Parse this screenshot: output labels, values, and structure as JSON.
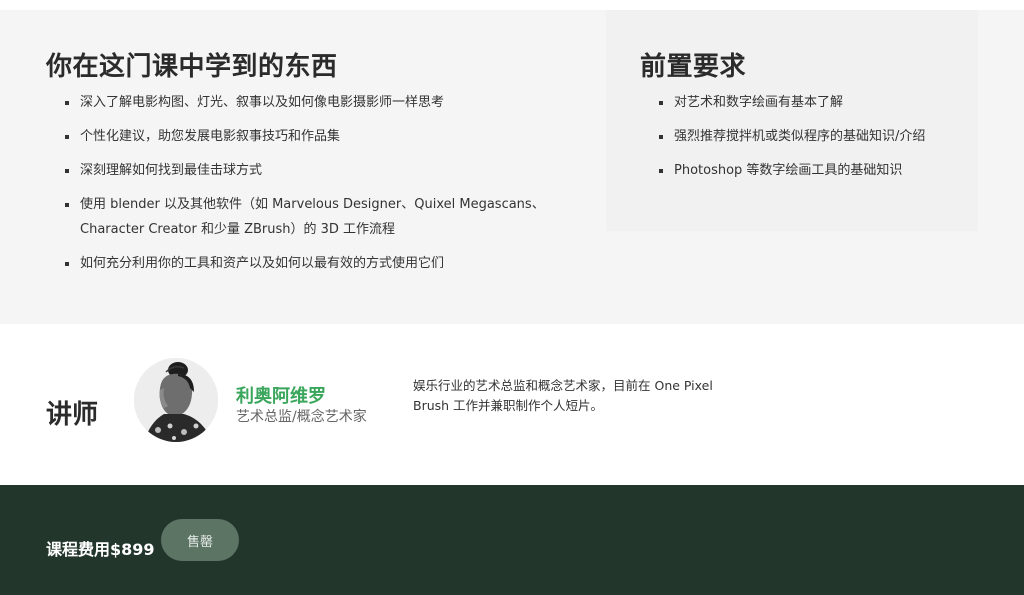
{
  "learn": {
    "title": "你在这门课中学到的东西",
    "items": [
      "深入了解电影构图、灯光、叙事以及如何像电影摄影师一样思考",
      "个性化建议，助您发展电影叙事技巧和作品集",
      "深刻理解如何找到最佳击球方式",
      "使用 blender 以及其他软件（如 Marvelous Designer、Quixel Megascans、Character Creator 和少量 ZBrush）的 3D 工作流程",
      "如何充分利用你的工具和资产以及如何以最有效的方式使用它们"
    ]
  },
  "prerequisites": {
    "title": "前置要求",
    "items": [
      "对艺术和数字绘画有基本了解",
      "强烈推荐搅拌机或类似程序的基础知识/介绍",
      "Photoshop 等数字绘画工具的基础知识"
    ]
  },
  "instructor": {
    "heading": "讲师",
    "name": "利奥阿维罗",
    "role": "艺术总监/概念艺术家",
    "bio": "娱乐行业的艺术总监和概念艺术家，目前在 One Pixel Brush 工作并兼职制作个人短片。"
  },
  "purchase": {
    "price_text": "课程费用$899",
    "button_label": "售罄"
  },
  "colors": {
    "accent_green": "#3aa65c",
    "footer_bg": "#22362c",
    "button_bg": "#5b7464"
  }
}
